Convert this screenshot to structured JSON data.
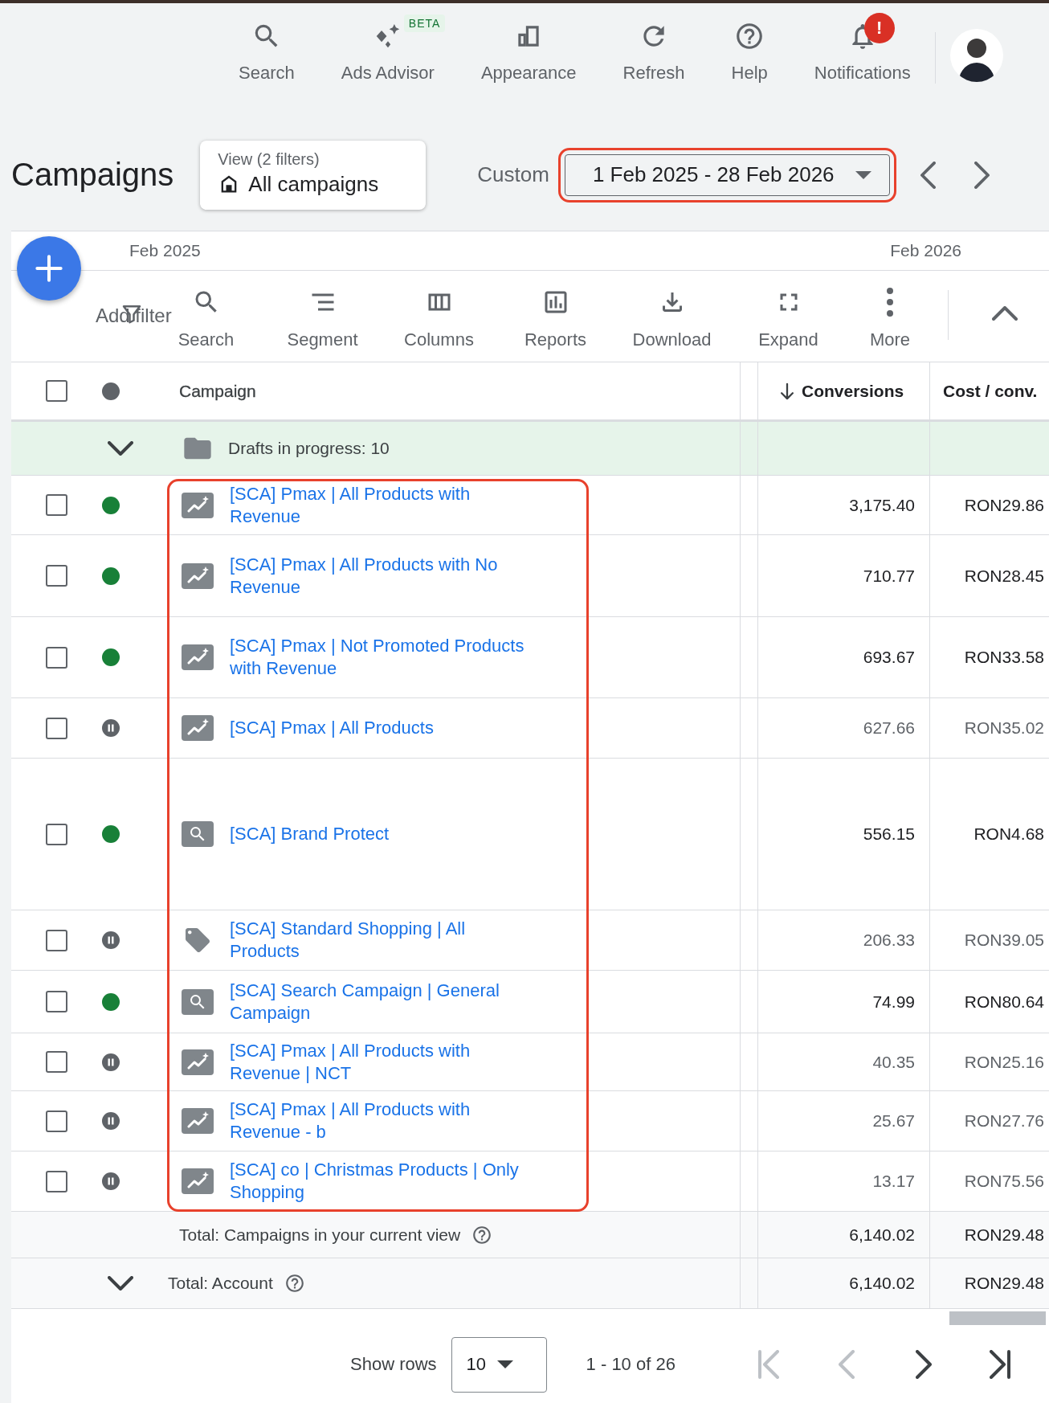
{
  "top_bar": {
    "actions": [
      {
        "kind": "search",
        "label": "Search"
      },
      {
        "kind": "advisor",
        "label": "Ads Advisor",
        "badge": "BETA"
      },
      {
        "kind": "appearance",
        "label": "Appearance"
      },
      {
        "kind": "refresh",
        "label": "Refresh"
      },
      {
        "kind": "help",
        "label": "Help"
      },
      {
        "kind": "notifications",
        "label": "Notifications",
        "alert": "!"
      }
    ]
  },
  "page": {
    "title": "Campaigns",
    "view": {
      "caption": "View (2 filters)",
      "name": "All campaigns"
    },
    "date_label": "Custom",
    "date_range": {
      "value": "1 Feb 2025 - 28 Feb 2026",
      "highlighted": true
    }
  },
  "timeline": {
    "start": "Feb 2025",
    "end": "Feb 2026"
  },
  "toolbar": {
    "add_filter": "Add filter",
    "actions": [
      {
        "kind": "search",
        "label": "Search"
      },
      {
        "kind": "segment",
        "label": "Segment"
      },
      {
        "kind": "columns",
        "label": "Columns"
      },
      {
        "kind": "reports",
        "label": "Reports"
      },
      {
        "kind": "download",
        "label": "Download"
      },
      {
        "kind": "expand",
        "label": "Expand"
      },
      {
        "kind": "more",
        "label": "More"
      }
    ]
  },
  "table": {
    "select_all": {
      "checked": false
    },
    "columns": [
      {
        "label": "Campaign",
        "sorted": false
      },
      {
        "label": "Conversions",
        "sorted": true
      },
      {
        "label": "Cost / conv.",
        "sorted": false
      }
    ],
    "drafts": {
      "label": "Drafts in progress: 10",
      "expanded": false
    },
    "campaign_names_highlighted": true,
    "rows": [
      {
        "name": "[SCA] Pmax | All Products with Revenue",
        "kind": "pmax",
        "paused": false,
        "checked": false,
        "conversions": "3,175.40",
        "cost_per_conv": "RON29.86"
      },
      {
        "name": "[SCA] Pmax | All Products with No Revenue",
        "kind": "pmax",
        "paused": false,
        "checked": false,
        "conversions": "710.77",
        "cost_per_conv": "RON28.45"
      },
      {
        "name": "[SCA] Pmax | Not Promoted Products with Revenue",
        "kind": "pmax",
        "paused": false,
        "checked": false,
        "conversions": "693.67",
        "cost_per_conv": "RON33.58"
      },
      {
        "name": "[SCA] Pmax | All Products",
        "kind": "pmax",
        "paused": true,
        "checked": false,
        "conversions": "627.66",
        "cost_per_conv": "RON35.02"
      },
      {
        "name": "[SCA] Brand Protect",
        "kind": "search",
        "paused": false,
        "checked": false,
        "conversions": "556.15",
        "cost_per_conv": "RON4.68"
      },
      {
        "name": "[SCA] Standard Shopping | All Products",
        "kind": "shopping",
        "paused": true,
        "checked": false,
        "conversions": "206.33",
        "cost_per_conv": "RON39.05"
      },
      {
        "name": "[SCA] Search Campaign | General Campaign",
        "kind": "search",
        "paused": false,
        "checked": false,
        "conversions": "74.99",
        "cost_per_conv": "RON80.64"
      },
      {
        "name": "[SCA] Pmax | All Products with Revenue | NCT",
        "kind": "pmax",
        "paused": true,
        "checked": false,
        "conversions": "40.35",
        "cost_per_conv": "RON25.16"
      },
      {
        "name": "[SCA] Pmax | All Products with Revenue - b",
        "kind": "pmax",
        "paused": true,
        "checked": false,
        "conversions": "25.67",
        "cost_per_conv": "RON27.76"
      },
      {
        "name": "[SCA] co | Christmas Products | Only Shopping",
        "kind": "pmax",
        "paused": true,
        "checked": false,
        "conversions": "13.17",
        "cost_per_conv": "RON75.56"
      }
    ],
    "totals": [
      {
        "kind": "view",
        "label": "Total: Campaigns in your current view",
        "conversions": "6,140.02",
        "cost_per_conv": "RON29.48"
      },
      {
        "kind": "account",
        "label": "Total: Account",
        "conversions": "6,140.02",
        "cost_per_conv": "RON29.48"
      }
    ]
  },
  "pagination": {
    "label": "Show rows",
    "rows_per_page": "10",
    "range": "1 - 10 of 26",
    "first": {
      "disabled": true
    },
    "prev": {
      "disabled": true
    },
    "next": {
      "disabled": false
    },
    "last": {
      "disabled": false
    }
  }
}
